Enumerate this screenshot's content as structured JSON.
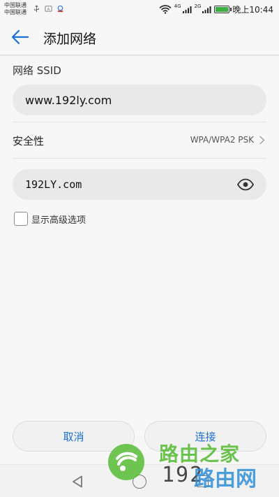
{
  "status_bar": {
    "carrier_lines": [
      "中国联通",
      "中国联通"
    ],
    "network_1": "4G",
    "network_2": "2G",
    "time": "晚上10:44",
    "battery_level": 0.9,
    "battery_color": "#3cb043"
  },
  "header": {
    "title": "添加网络",
    "back_icon": "arrow-left-icon"
  },
  "form": {
    "ssid_label": "网络 SSID",
    "ssid_value": "www.192ly.com",
    "security_label": "安全性",
    "security_value": "WPA/WPA2 PSK",
    "password_value": "192LY.com",
    "show_advanced_label": "显示高级选项",
    "show_advanced_checked": false
  },
  "actions": {
    "cancel_label": "取消",
    "connect_label": "连接"
  },
  "colors": {
    "accent": "#1a6fd8",
    "background": "#f7f7f7",
    "field_bg": "#e9e9e9"
  },
  "watermark": {
    "line1": "路由之家",
    "line2": "192",
    "line3": "路由网"
  }
}
